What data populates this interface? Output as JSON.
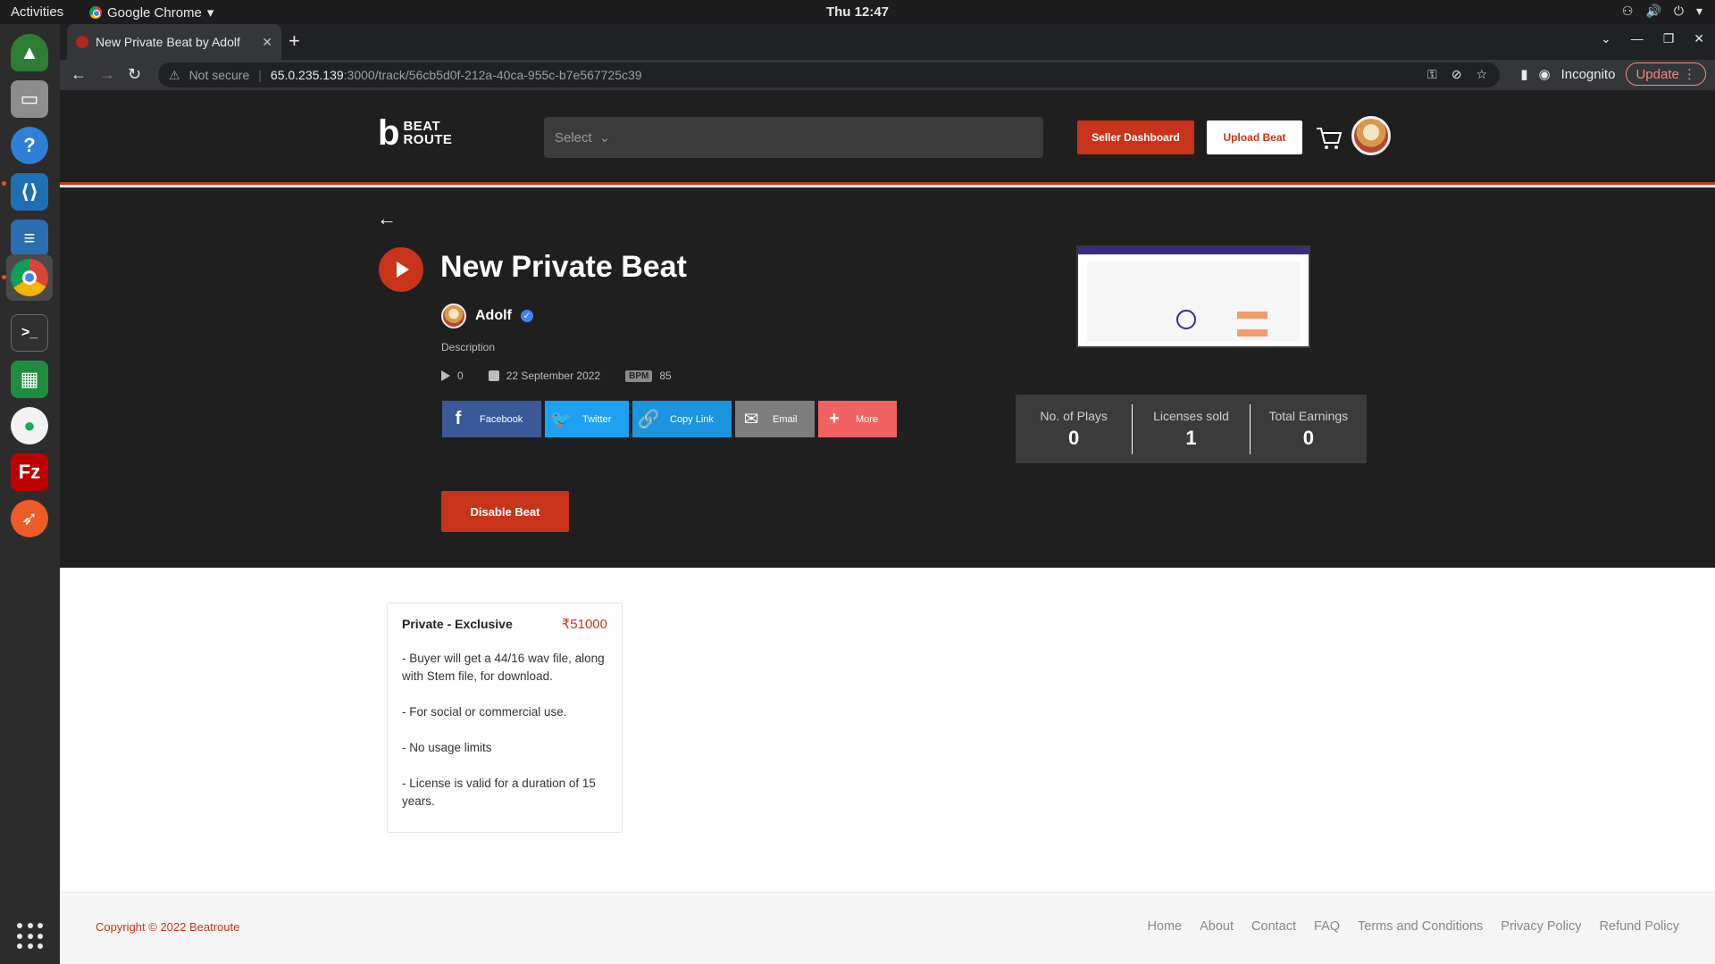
{
  "os": {
    "activities": "Activities",
    "app_name": "Google Chrome",
    "clock": "Thu 12:47"
  },
  "browser": {
    "tab_title": "New Private Beat by Adolf",
    "not_secure": "Not secure",
    "url_host": "65.0.235.139",
    "url_path": ":3000/track/56cb5d0f-212a-40ca-955c-b7e567725c39",
    "incognito": "Incognito",
    "update": "Update"
  },
  "header": {
    "logo_top": "BEAT",
    "logo_bottom": "ROUTE",
    "select_placeholder": "Select",
    "seller_dashboard": "Seller Dashboard",
    "upload_beat": "Upload Beat"
  },
  "beat": {
    "title": "New Private Beat",
    "artist": "Adolf",
    "description_label": "Description",
    "plays": "0",
    "date": "22 September 2022",
    "bpm_label": "BPM",
    "bpm": "85",
    "disable_button": "Disable Beat"
  },
  "share": {
    "facebook": "Facebook",
    "twitter": "Twitter",
    "copy_link": "Copy Link",
    "email": "Email",
    "more": "More"
  },
  "stats": [
    {
      "label": "No. of Plays",
      "value": "0"
    },
    {
      "label": "Licenses sold",
      "value": "1"
    },
    {
      "label": "Total Earnings",
      "value": "0"
    }
  ],
  "license": {
    "name": "Private - Exclusive",
    "price": "₹51000",
    "lines": [
      "- Buyer will get a 44/16 wav file, along with Stem file, for download.",
      "- For social or commercial use.",
      "- No usage limits",
      "- License is valid for a duration of 15 years."
    ]
  },
  "footer": {
    "copyright": "Copyright © 2022 Beatroute",
    "links": [
      "Home",
      "About",
      "Contact",
      "FAQ",
      "Terms and Conditions",
      "Privacy Policy",
      "Refund Policy"
    ]
  },
  "colors": {
    "brand": "#c9331a",
    "header_bg": "#1f1f1f"
  }
}
